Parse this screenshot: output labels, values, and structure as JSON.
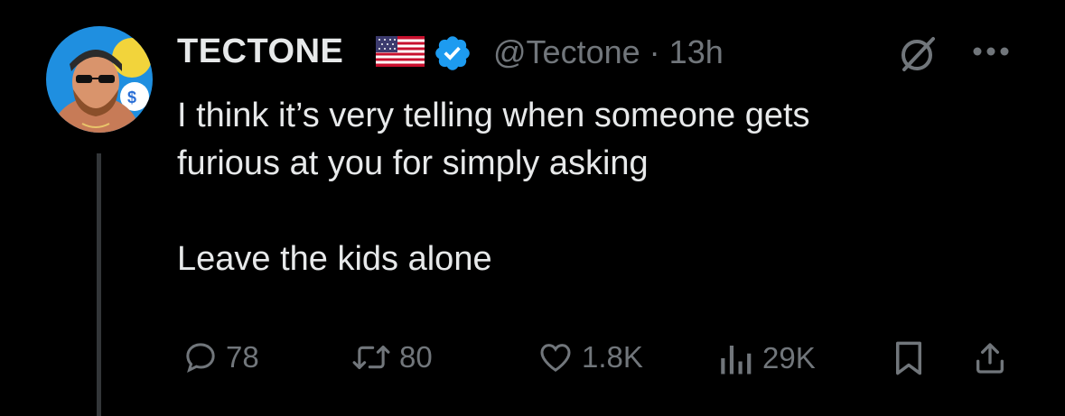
{
  "tweet": {
    "display_name": "TECTONE",
    "handle": "@Tectone",
    "separator": "·",
    "time": "13h",
    "text_lines": [
      "I think it’s very telling when someone gets",
      "furious at you for simply asking"
    ],
    "text_line_2": "Leave the kids alone",
    "badges": {
      "flag_icon": "us-flag-icon",
      "verified_icon": "verified-badge-icon",
      "verified_color": "#1d9bf0"
    }
  },
  "actions": {
    "replies": "78",
    "reposts": "80",
    "likes": "1.8K",
    "views": "29K"
  },
  "colors": {
    "background": "#000000",
    "primary_text": "#e7e9ea",
    "secondary_text": "#71767b",
    "thread_line": "#333639"
  }
}
